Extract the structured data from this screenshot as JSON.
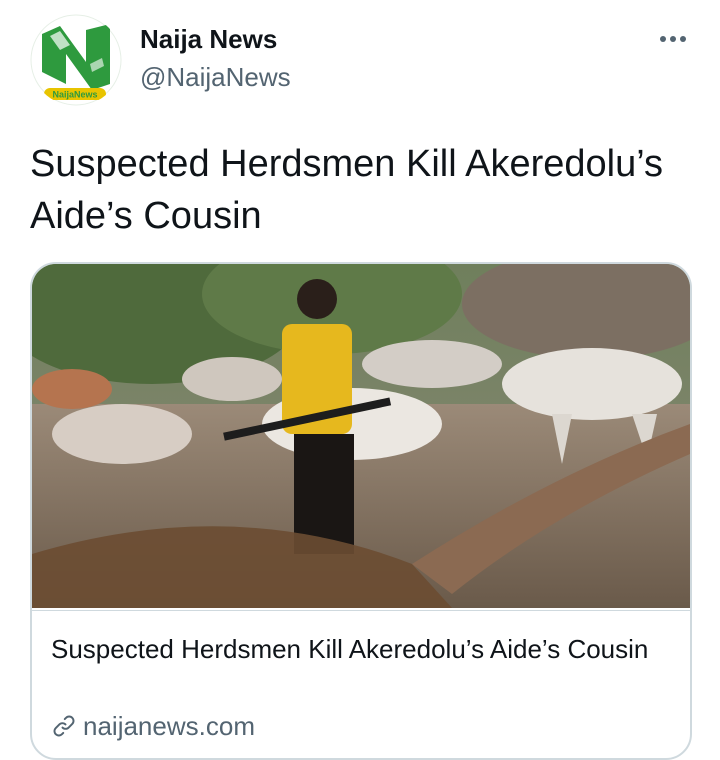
{
  "author": {
    "name": "Naija News",
    "handle": "@NaijaNews",
    "avatar_icon": "naija-news-logo",
    "avatar_logo_text": "NaijaNews"
  },
  "menu": {
    "icon": "more-horizontal-icon",
    "glyph": "•••"
  },
  "tweet": {
    "text": "Suspected Herdsmen Kill Akeredolu’s Aide’s Cousin"
  },
  "card": {
    "image_alt": "Herdsman with rifle among cattle",
    "title": "Suspected Herdsmen Kill Akeredolu’s Aide’s Cousin",
    "domain": "naijanews.com",
    "link_icon": "link-icon"
  },
  "colors": {
    "text_primary": "#0f1419",
    "text_secondary": "#536471",
    "border": "#cfd9de",
    "logo_green": "#2e9a3e"
  }
}
